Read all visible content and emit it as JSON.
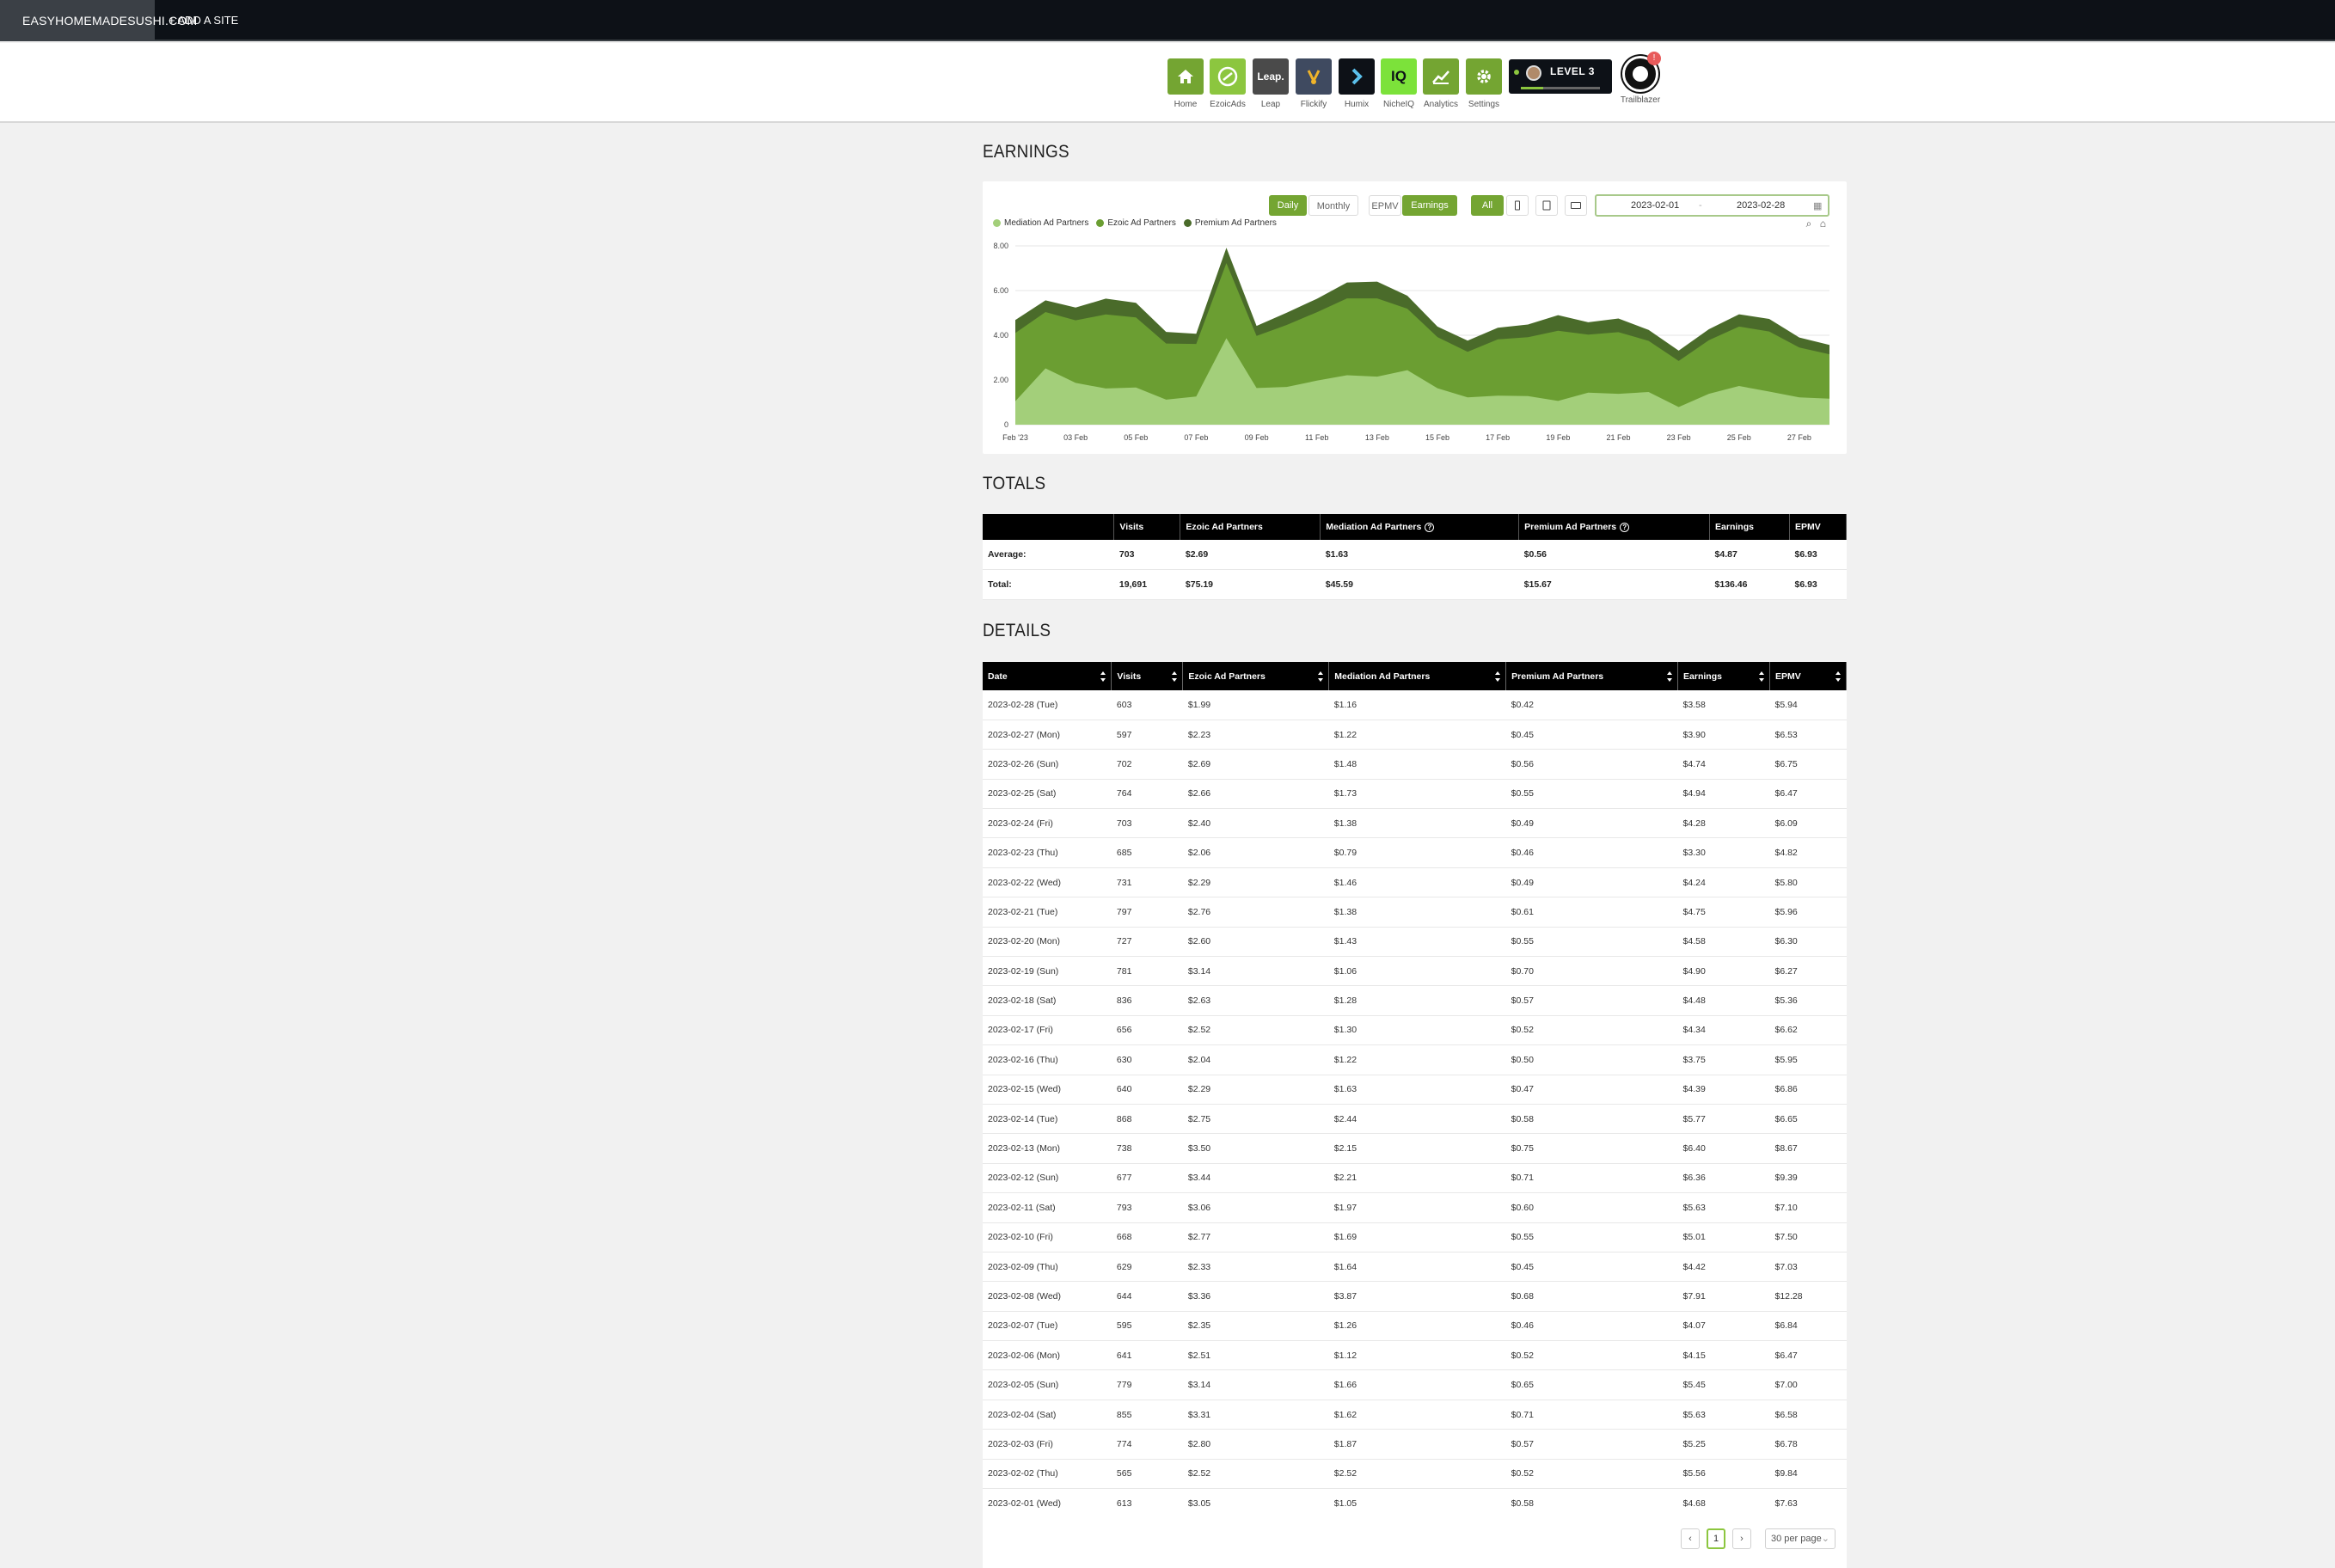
{
  "topbar": {
    "site_name": "EASYHOMEMADESUSHI.COM",
    "add_site": "+ ADD A SITE"
  },
  "nav": {
    "items": [
      {
        "label": "Home",
        "color": "#74a532"
      },
      {
        "label": "EzoicAds",
        "color": "#8cc63f"
      },
      {
        "label": "Leap",
        "color": "#4a4a4a"
      },
      {
        "label": "Flickify",
        "color": "#3f4a60"
      },
      {
        "label": "Humix",
        "color": "#0d1117"
      },
      {
        "label": "NicheIQ",
        "color": "#7ce23a"
      },
      {
        "label": "Analytics",
        "color": "#74a532"
      },
      {
        "label": "Settings",
        "color": "#74a532"
      }
    ],
    "leap_logo": "Leap.",
    "niche_logo": "IQ",
    "level": "LEVEL 3",
    "level_progress": 0.28,
    "trailblazer": "Trailblazer"
  },
  "earnings": {
    "title": "EARNINGS",
    "buttons": {
      "daily": "Daily",
      "monthly": "Monthly",
      "epmv": "EPMV",
      "earnings": "Earnings",
      "all": "All"
    },
    "date_start": "2023-02-01",
    "date_sep": "-",
    "date_end": "2023-02-28"
  },
  "chart_data": {
    "type": "area",
    "stacked": true,
    "x": [
      "Feb '23",
      "02 Feb",
      "03 Feb",
      "04 Feb",
      "05 Feb",
      "06 Feb",
      "07 Feb",
      "08 Feb",
      "09 Feb",
      "10 Feb",
      "11 Feb",
      "12 Feb",
      "13 Feb",
      "14 Feb",
      "15 Feb",
      "16 Feb",
      "17 Feb",
      "18 Feb",
      "19 Feb",
      "20 Feb",
      "21 Feb",
      "22 Feb",
      "23 Feb",
      "24 Feb",
      "25 Feb",
      "26 Feb",
      "27 Feb",
      "28 Feb"
    ],
    "x_tick_labels": [
      "Feb '23",
      "03 Feb",
      "05 Feb",
      "07 Feb",
      "09 Feb",
      "11 Feb",
      "13 Feb",
      "15 Feb",
      "17 Feb",
      "19 Feb",
      "21 Feb",
      "23 Feb",
      "25 Feb",
      "27 Feb"
    ],
    "series": [
      {
        "name": "Mediation Ad Partners",
        "color": "#a3cf7a",
        "values": [
          1.05,
          2.52,
          1.87,
          1.62,
          1.66,
          1.12,
          1.26,
          3.87,
          1.64,
          1.69,
          1.97,
          2.21,
          2.15,
          2.44,
          1.63,
          1.22,
          1.3,
          1.28,
          1.06,
          1.43,
          1.38,
          1.46,
          0.79,
          1.38,
          1.73,
          1.48,
          1.22,
          1.16
        ]
      },
      {
        "name": "Ezoic Ad Partners",
        "color": "#6b9e32",
        "values": [
          3.05,
          2.52,
          2.8,
          3.31,
          3.14,
          2.51,
          2.35,
          3.36,
          2.33,
          2.77,
          3.06,
          3.44,
          3.5,
          2.75,
          2.29,
          2.04,
          2.52,
          2.63,
          3.14,
          2.6,
          2.76,
          2.29,
          2.06,
          2.4,
          2.66,
          2.69,
          2.23,
          1.99
        ]
      },
      {
        "name": "Premium Ad Partners",
        "color": "#4a6b2a",
        "values": [
          0.58,
          0.52,
          0.57,
          0.71,
          0.65,
          0.52,
          0.46,
          0.68,
          0.45,
          0.55,
          0.6,
          0.71,
          0.75,
          0.58,
          0.47,
          0.5,
          0.52,
          0.57,
          0.7,
          0.55,
          0.61,
          0.49,
          0.46,
          0.49,
          0.55,
          0.56,
          0.45,
          0.42
        ]
      }
    ],
    "y_ticks": [
      "0",
      "2.00",
      "4.00",
      "6.00",
      "8.00"
    ],
    "ylim": [
      0,
      8
    ],
    "grid": true,
    "legend": "top-left"
  },
  "totals": {
    "title": "TOTALS",
    "headers": [
      "",
      "Visits",
      "Ezoic Ad Partners",
      "Mediation Ad Partners",
      "Premium Ad Partners",
      "Earnings",
      "EPMV"
    ],
    "rows": [
      [
        "Average:",
        "703",
        "$2.69",
        "$1.63",
        "$0.56",
        "$4.87",
        "$6.93"
      ],
      [
        "Total:",
        "19,691",
        "$75.19",
        "$45.59",
        "$15.67",
        "$136.46",
        "$6.93"
      ]
    ]
  },
  "details": {
    "title": "DETAILS",
    "headers": [
      "Date",
      "Visits",
      "Ezoic Ad Partners",
      "Mediation Ad Partners",
      "Premium Ad Partners",
      "Earnings",
      "EPMV"
    ],
    "rows": [
      [
        "2023-02-28 (Tue)",
        "603",
        "$1.99",
        "$1.16",
        "$0.42",
        "$3.58",
        "$5.94"
      ],
      [
        "2023-02-27 (Mon)",
        "597",
        "$2.23",
        "$1.22",
        "$0.45",
        "$3.90",
        "$6.53"
      ],
      [
        "2023-02-26 (Sun)",
        "702",
        "$2.69",
        "$1.48",
        "$0.56",
        "$4.74",
        "$6.75"
      ],
      [
        "2023-02-25 (Sat)",
        "764",
        "$2.66",
        "$1.73",
        "$0.55",
        "$4.94",
        "$6.47"
      ],
      [
        "2023-02-24 (Fri)",
        "703",
        "$2.40",
        "$1.38",
        "$0.49",
        "$4.28",
        "$6.09"
      ],
      [
        "2023-02-23 (Thu)",
        "685",
        "$2.06",
        "$0.79",
        "$0.46",
        "$3.30",
        "$4.82"
      ],
      [
        "2023-02-22 (Wed)",
        "731",
        "$2.29",
        "$1.46",
        "$0.49",
        "$4.24",
        "$5.80"
      ],
      [
        "2023-02-21 (Tue)",
        "797",
        "$2.76",
        "$1.38",
        "$0.61",
        "$4.75",
        "$5.96"
      ],
      [
        "2023-02-20 (Mon)",
        "727",
        "$2.60",
        "$1.43",
        "$0.55",
        "$4.58",
        "$6.30"
      ],
      [
        "2023-02-19 (Sun)",
        "781",
        "$3.14",
        "$1.06",
        "$0.70",
        "$4.90",
        "$6.27"
      ],
      [
        "2023-02-18 (Sat)",
        "836",
        "$2.63",
        "$1.28",
        "$0.57",
        "$4.48",
        "$5.36"
      ],
      [
        "2023-02-17 (Fri)",
        "656",
        "$2.52",
        "$1.30",
        "$0.52",
        "$4.34",
        "$6.62"
      ],
      [
        "2023-02-16 (Thu)",
        "630",
        "$2.04",
        "$1.22",
        "$0.50",
        "$3.75",
        "$5.95"
      ],
      [
        "2023-02-15 (Wed)",
        "640",
        "$2.29",
        "$1.63",
        "$0.47",
        "$4.39",
        "$6.86"
      ],
      [
        "2023-02-14 (Tue)",
        "868",
        "$2.75",
        "$2.44",
        "$0.58",
        "$5.77",
        "$6.65"
      ],
      [
        "2023-02-13 (Mon)",
        "738",
        "$3.50",
        "$2.15",
        "$0.75",
        "$6.40",
        "$8.67"
      ],
      [
        "2023-02-12 (Sun)",
        "677",
        "$3.44",
        "$2.21",
        "$0.71",
        "$6.36",
        "$9.39"
      ],
      [
        "2023-02-11 (Sat)",
        "793",
        "$3.06",
        "$1.97",
        "$0.60",
        "$5.63",
        "$7.10"
      ],
      [
        "2023-02-10 (Fri)",
        "668",
        "$2.77",
        "$1.69",
        "$0.55",
        "$5.01",
        "$7.50"
      ],
      [
        "2023-02-09 (Thu)",
        "629",
        "$2.33",
        "$1.64",
        "$0.45",
        "$4.42",
        "$7.03"
      ],
      [
        "2023-02-08 (Wed)",
        "644",
        "$3.36",
        "$3.87",
        "$0.68",
        "$7.91",
        "$12.28"
      ],
      [
        "2023-02-07 (Tue)",
        "595",
        "$2.35",
        "$1.26",
        "$0.46",
        "$4.07",
        "$6.84"
      ],
      [
        "2023-02-06 (Mon)",
        "641",
        "$2.51",
        "$1.12",
        "$0.52",
        "$4.15",
        "$6.47"
      ],
      [
        "2023-02-05 (Sun)",
        "779",
        "$3.14",
        "$1.66",
        "$0.65",
        "$5.45",
        "$7.00"
      ],
      [
        "2023-02-04 (Sat)",
        "855",
        "$3.31",
        "$1.62",
        "$0.71",
        "$5.63",
        "$6.58"
      ],
      [
        "2023-02-03 (Fri)",
        "774",
        "$2.80",
        "$1.87",
        "$0.57",
        "$5.25",
        "$6.78"
      ],
      [
        "2023-02-02 (Thu)",
        "565",
        "$2.52",
        "$2.52",
        "$0.52",
        "$5.56",
        "$9.84"
      ],
      [
        "2023-02-01 (Wed)",
        "613",
        "$3.05",
        "$1.05",
        "$0.58",
        "$4.68",
        "$7.63"
      ]
    ]
  },
  "pagination": {
    "prev": "‹",
    "current": "1",
    "next": "›",
    "per_page": "30 per page"
  },
  "colors": {
    "accent": "#74a532",
    "dark": "#0d1117"
  }
}
